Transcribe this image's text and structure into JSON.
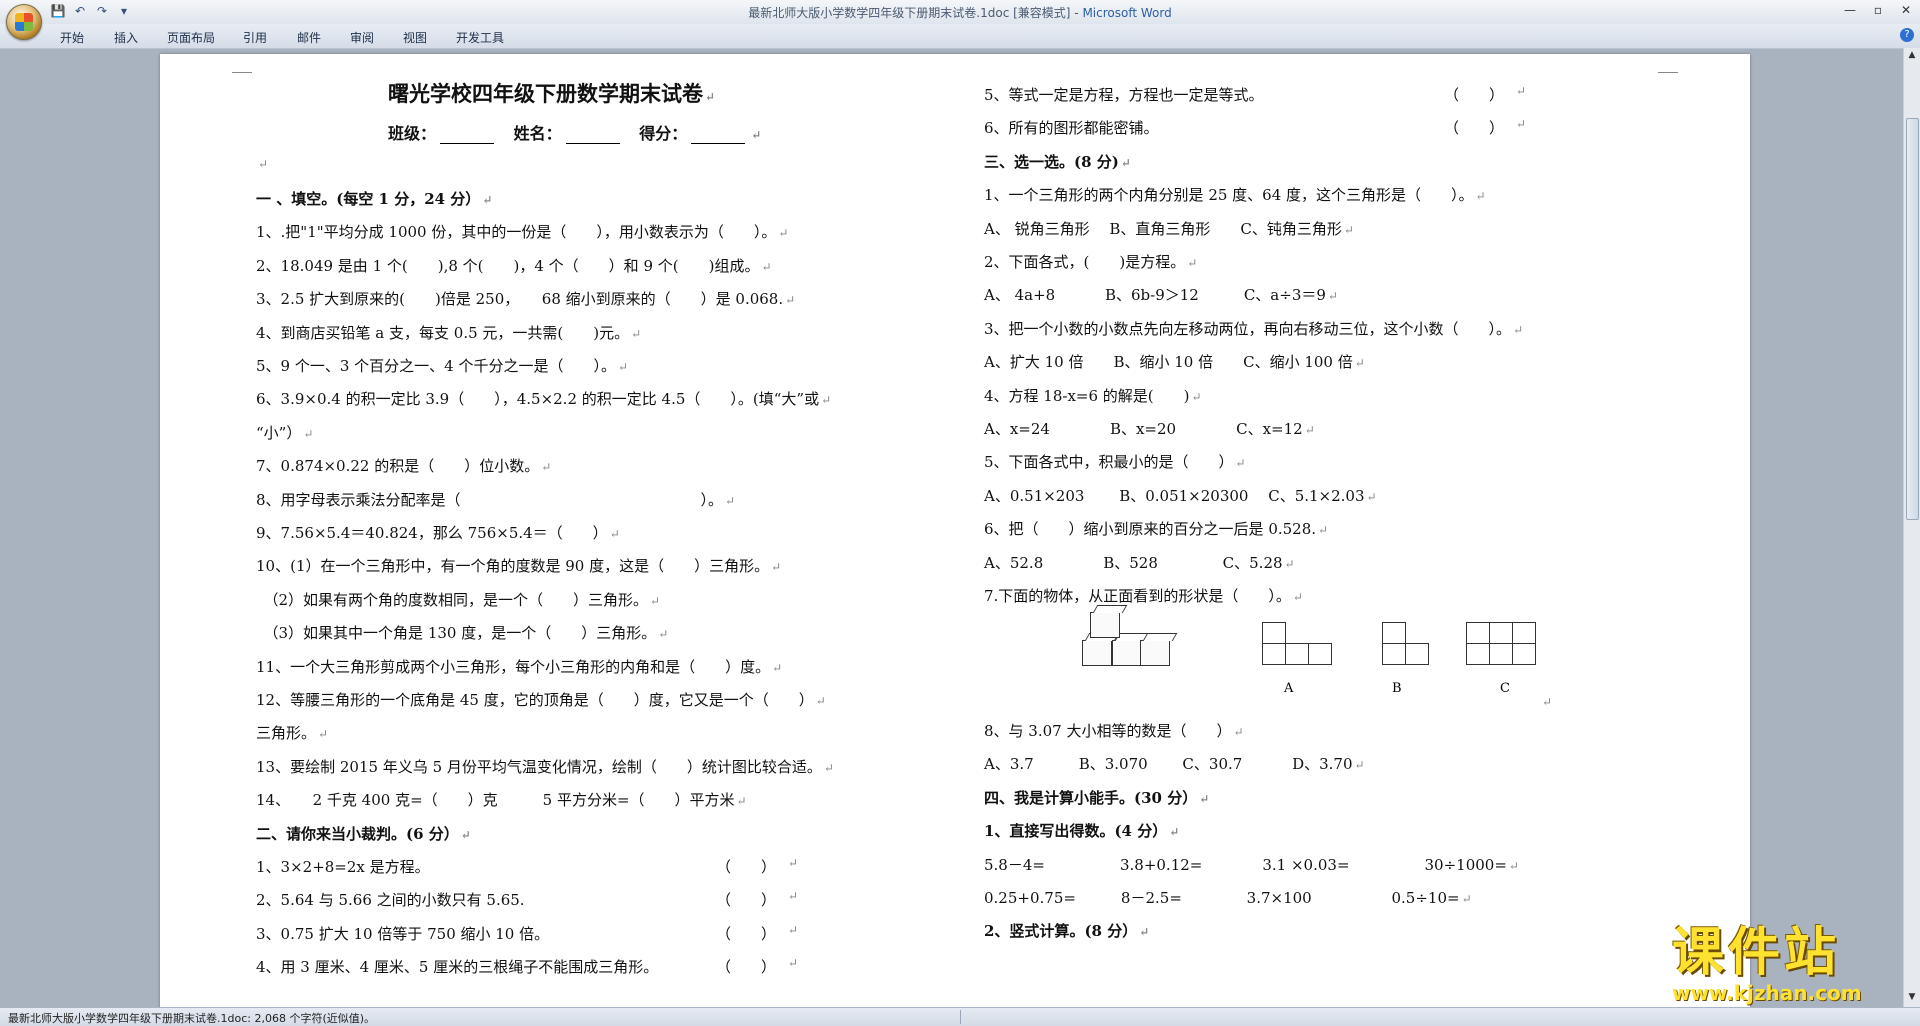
{
  "window": {
    "title_doc": "最新北师大版小学数学四年级下册期末试卷.1doc [兼容模式] - ",
    "title_app": "Microsoft Word"
  },
  "ribbon_tabs": [
    "开始",
    "插入",
    "页面布局",
    "引用",
    "邮件",
    "审阅",
    "视图",
    "开发工具"
  ],
  "doc": {
    "title": "曙光学校四年级下册数学期末试卷",
    "info": {
      "class_label": "班级：",
      "name_label": "姓名：",
      "score_label": "得分："
    },
    "left": [
      {
        "t": "一 、填空。(每空 1 分，24 分）",
        "bold": true
      },
      {
        "t": "1、.把\"1\"平均分成 1000 份，其中的一份是（　　），用小数表示为（　　）。"
      },
      {
        "t": "2、18.049 是由 1 个(　　),8 个(　　)，4 个（　　）和 9 个(　　)组成。"
      },
      {
        "t": "3、2.5 扩大到原来的(　　)倍是 250，　　68 缩小到原来的（　　）是 0.068."
      },
      {
        "t": "4、到商店买铅笔 a 支，每支 0.5 元，一共需(　　)元。"
      },
      {
        "t": "5、9 个一、3 个百分之一、4 个千分之一是（　　）。"
      },
      {
        "t": "6、3.9×0.4 的积一定比 3.9（　　），4.5×2.2 的积一定比 4.5（　　）。(填“大”或"
      },
      {
        "t": "“小”）"
      },
      {
        "t": "7、0.874×0.22 的积是（　　）位小数。"
      },
      {
        "t": "8、用字母表示乘法分配率是（　　　　　　　　　　　　　　　　）。"
      },
      {
        "t": "9、7.56×5.4＝40.824，那么 756×5.4＝（　　）"
      },
      {
        "t": "10、(1）在一个三角形中，有一个角的度数是 90 度，这是（　　）三角形。"
      },
      {
        "t": "　（2）如果有两个角的度数相同，是一个（　　）三角形。"
      },
      {
        "t": "　（3）如果其中一个角是 130 度，是一个（　　）三角形。"
      },
      {
        "t": "11、一个大三角形剪成两个小三角形，每个小三角形的内角和是（　　）度。"
      },
      {
        "t": "12、等腰三角形的一个底角是 45 度，它的顶角是（　　）度，它又是一个（　　）"
      },
      {
        "t": "三角形。"
      },
      {
        "t": "13、要绘制 2015 年义乌 5 月份平均气温变化情况，绘制（　　）统计图比较合适。"
      },
      {
        "t": "14、　　2 千克 400 克=（　　）克　　　5 平方分米=（　　）平方米"
      },
      {
        "t": "二、请你来当小裁判。(6 分）",
        "bold": true
      },
      {
        "t": "1、3×2+8=2x 是方程。",
        "j": "（　　）"
      },
      {
        "t": "2、5.64 与 5.66 之间的小数只有 5.65.",
        "j": "（　　）"
      },
      {
        "t": "3、0.75 扩大 10 倍等于 750 缩小 10 倍。",
        "j": "（　　）"
      },
      {
        "t": "4、用 3 厘米、4 厘米、5 厘米的三根绳子不能围成三角形。",
        "j": "（　　）"
      }
    ],
    "right": [
      {
        "t": "5、等式一定是方程，方程也一定是等式。",
        "j": "（　　）"
      },
      {
        "t": "6、所有的图形都能密铺。",
        "j": "（　　）"
      },
      {
        "t": "三、选一选。(8 分)",
        "bold": true
      },
      {
        "t": "1、一个三角形的两个内角分别是 25 度、64 度，这个三角形是（　　）。"
      },
      {
        "t": "A、 锐角三角形　 B、直角三角形　　C、钝角三角形"
      },
      {
        "t": "2、下面各式，(　　)是方程。"
      },
      {
        "t": "A、 4a+8　　　 B、6b-9＞12　　　C、a÷3＝9"
      },
      {
        "t": "3、把一个小数的小数点先向左移动两位，再向右移动三位，这个小数（　　）。"
      },
      {
        "t": "A、扩大 10 倍　　B、缩小 10 倍　　C、缩小 100 倍"
      },
      {
        "t": "4、方程 18-x=6 的解是(　　)"
      },
      {
        "t": "A、x=24　　　　B、x=20　　　　C、x=12"
      },
      {
        "t": "5、下面各式中，积最小的是（　　）"
      },
      {
        "t": "A、0.51×203　　 B、0.051×20300　 C、5.1×2.03"
      },
      {
        "t": "6、把（　　）缩小到原来的百分之一后是 0.528."
      },
      {
        "t": "A、52.8　　　　B、528　　　　 C、5.28"
      },
      {
        "t": "7.下面的物体，从正面看到的形状是（　　）。"
      }
    ],
    "right2": [
      {
        "t": "8、与 3.07 大小相等的数是（　　）"
      },
      {
        "t": "A、3.7　　　B、3.070　　 C、30.7　　　 D、3.70"
      },
      {
        "t": "四、我是计算小能手。(30 分）",
        "bold": true
      },
      {
        "t": "1、直接写出得数。(4 分）",
        "bold": true
      },
      {
        "t": "5.8－4=　　　　　3.8+0.12=　　　　3.1 ×0.03=　　　　　30÷1000="
      },
      {
        "t": "0.25+0.75=　　　8－2.5=　　　　 3.7×100　　　　　 0.5÷10="
      },
      {
        "t": "2、竖式计算。(8 分）",
        "bold": true
      }
    ],
    "figure_labels": [
      "A",
      "B",
      "C"
    ]
  },
  "status": "最新北师大版小学数学四年级下册期末试卷.1doc: 2,068 个字符(近似值)。",
  "watermark": {
    "text": "课件站",
    "url": "www.kjzhan.com"
  }
}
